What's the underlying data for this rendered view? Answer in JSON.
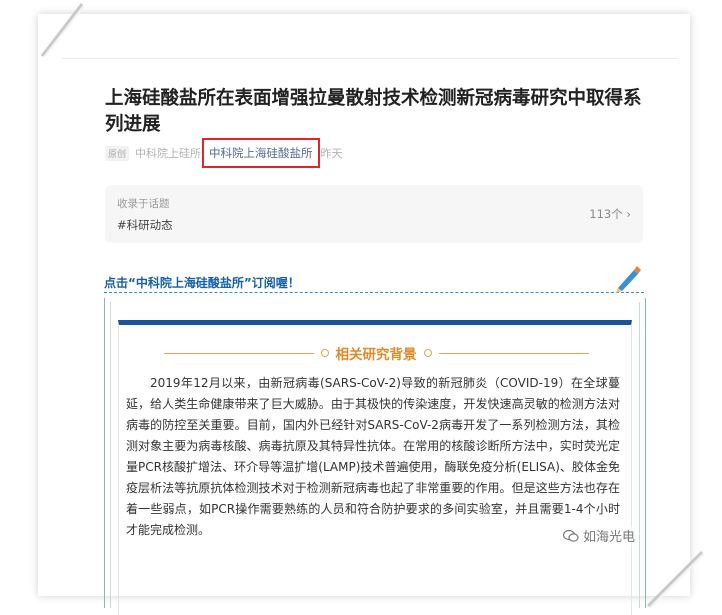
{
  "article": {
    "title": "上海硅酸盐所在表面增强拉曼散射技术检测新冠病毒研究中取得系列进展",
    "original_tag": "原创",
    "source": "中科院上硅所",
    "account": "中科院上海硅酸盐所",
    "time": "昨天"
  },
  "topic": {
    "label": "收录于话题",
    "tag": "#科研动态",
    "count": "113个 ›"
  },
  "follow_banner": {
    "text": "点击“中科院上海硅酸盐所”订阅喔！"
  },
  "section": {
    "title": "相关研究背景",
    "body": "2019年12月以来，由新冠病毒(SARS-CoV-2)导致的新冠肺炎（COVID-19）在全球蔓延，给人类生命健康带来了巨大威胁。由于其极快的传染速度，开发快速高灵敏的检测方法对病毒的防控至关重要。目前，国内外已经针对SARS-CoV-2病毒开发了一系列检测方法，其检测对象主要为病毒核酸、病毒抗原及其特异性抗体。在常用的核酸诊断所方法中，实时荧光定量PCR核酸扩增法、环介导等温扩增(LAMP)技术普遍使用，酶联免疫分析(ELISA)、胶体金免疫层析法等抗原抗体检测技术对于检测新冠病毒也起了非常重要的作用。但是这些方法也存在着一些弱点，如PCR操作需要熟练的人员和符合防护要求的多间实验室，并且需要1-4个小时才能完成检测。"
  },
  "watermark": {
    "text": "如海光电"
  },
  "colors": {
    "highlight_box": "#e0262b",
    "account_link": "#576b95",
    "banner_text": "#1560a8",
    "section_border": "#1a53a0",
    "section_title": "#e08a2a"
  }
}
